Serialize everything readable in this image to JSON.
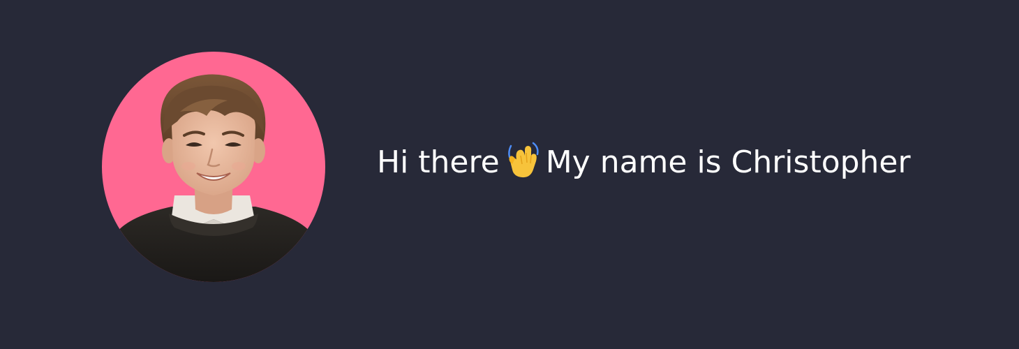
{
  "profile": {
    "greeting_prefix": "Hi there",
    "wave_icon": "waving-hand-icon",
    "greeting_suffix": "My name is Christopher"
  },
  "colors": {
    "background": "#272938",
    "avatar_background": "#ff6892",
    "text": "#ffffff"
  }
}
